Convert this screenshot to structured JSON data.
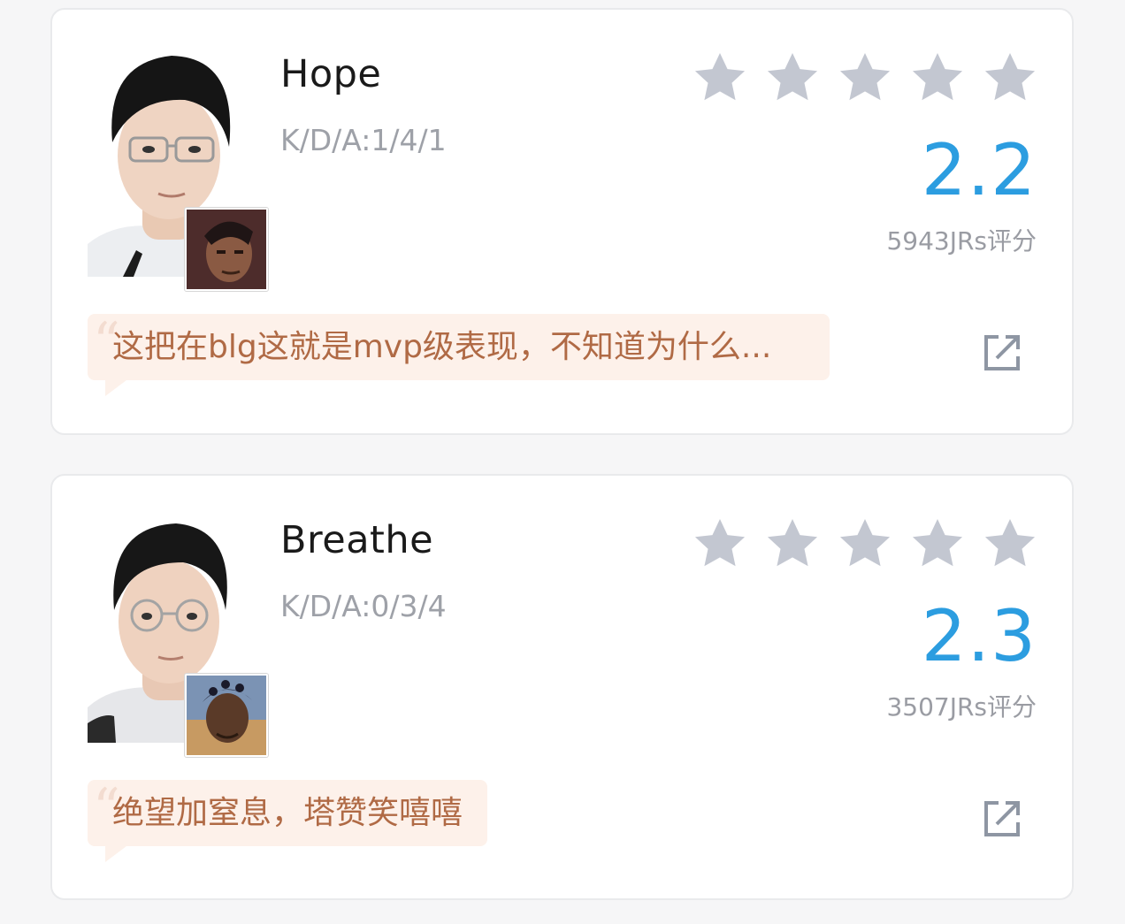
{
  "colors": {
    "score_blue": "#2c9de0",
    "star_gray": "#c3c7d1",
    "quote_bg": "#fdf1ea",
    "quote_text": "#b06a45",
    "muted_text": "#9ea1a8"
  },
  "players": [
    {
      "name": "Hope",
      "kda": "K/D/A:1/4/1",
      "stars_filled": 0,
      "stars_total": 5,
      "score": "2.2",
      "rating_count": "5943JRs评分",
      "comment": "这把在blg这就是mvp级表现，不知道为什么...",
      "champion_icon": "champion-portrait-icon",
      "share_icon": "share-external-icon"
    },
    {
      "name": "Breathe",
      "kda": "K/D/A:0/3/4",
      "stars_filled": 0,
      "stars_total": 5,
      "score": "2.3",
      "rating_count": "3507JRs评分",
      "comment": "绝望加窒息，塔赞笑嘻嘻",
      "champion_icon": "champion-portrait-icon",
      "share_icon": "share-external-icon"
    }
  ]
}
